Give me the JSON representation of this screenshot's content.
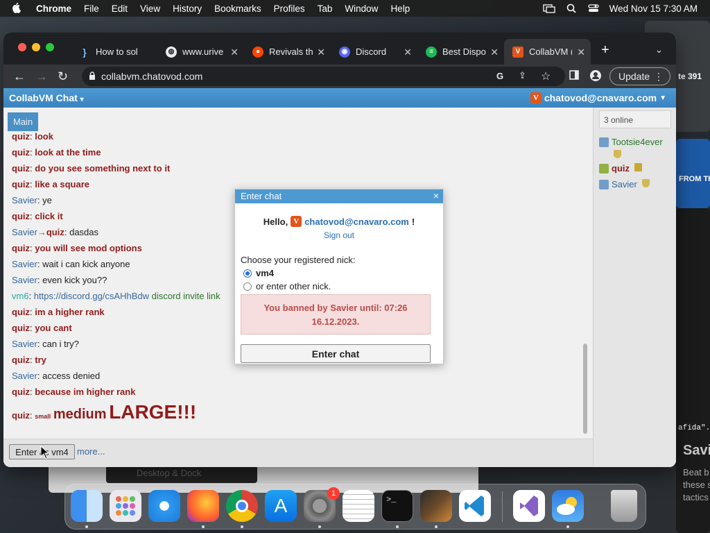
{
  "menubar": {
    "app": "Chrome",
    "items": [
      "File",
      "Edit",
      "View",
      "History",
      "Bookmarks",
      "Profiles",
      "Tab",
      "Window",
      "Help"
    ],
    "datetime": "Wed Nov 15  7:30 AM"
  },
  "background": {
    "right_number": "te 391",
    "from_text": "FROM TH",
    "code_snippet": "afida\".",
    "heading": "Savi",
    "lines": [
      "Beat b",
      "these s",
      "tactics"
    ],
    "desktop_dock": "Desktop & Dock"
  },
  "browser": {
    "tabs": [
      {
        "label": "How to sol",
        "icon": "bracket-icon"
      },
      {
        "label": "www.urive",
        "icon": "globe-icon"
      },
      {
        "label": "Revivals th",
        "icon": "reddit-icon"
      },
      {
        "label": "Discord",
        "icon": "discord-icon"
      },
      {
        "label": "Best Dispo",
        "icon": "spotify-icon"
      },
      {
        "label": "CollabVM (",
        "icon": "collabvm-icon"
      }
    ],
    "url": "collabvm.chatovod.com",
    "update_label": "Update"
  },
  "page": {
    "brand": "CollabVM Chat",
    "brand_caret": "▾",
    "user_email": "chatovod@cnavaro.com",
    "main_tab": "Main",
    "online_count": "3 online",
    "users": [
      {
        "name": "Tootsie4ever",
        "color": "#2a7d2a",
        "badge": "shield"
      },
      {
        "name": "quiz",
        "color": "#9b1d1d",
        "badge": "crown"
      },
      {
        "name": "Savier",
        "color": "#3a6ea5",
        "badge": "shield"
      }
    ],
    "messages": [
      {
        "author": "quiz",
        "sep": ": ",
        "text": "look"
      },
      {
        "author": "quiz",
        "sep": ": ",
        "text": "look at the time"
      },
      {
        "author": "quiz",
        "sep": ": ",
        "text": "do you see something next to it"
      },
      {
        "author": "quiz",
        "sep": ": ",
        "text": "like a square"
      },
      {
        "author": "Savier",
        "sep": ": ",
        "text": "ye"
      },
      {
        "author": "quiz",
        "sep": ": ",
        "text": "click it"
      },
      {
        "author": "Savier",
        "arrow": "→",
        "to": "quiz",
        "sep": ": ",
        "text": "dasdas"
      },
      {
        "author": "quiz",
        "sep": ": ",
        "text": "you will see mod options"
      },
      {
        "author": "Savier",
        "sep": ": ",
        "text": "wait i can kick anyone"
      },
      {
        "author": "Savier",
        "sep": ": ",
        "text": "even kick you??"
      },
      {
        "author": "vm6",
        "sep": ": ",
        "link": "https://discord.gg/csAHhBdw",
        "text": " discord invite link"
      },
      {
        "author": "quiz",
        "sep": ": ",
        "text": "im a higher rank"
      },
      {
        "author": "quiz",
        "sep": ": ",
        "text": "you cant"
      },
      {
        "author": "Savier",
        "sep": ": ",
        "text": "can i try?"
      },
      {
        "author": "quiz",
        "sep": ": ",
        "text": "try"
      },
      {
        "author": "Savier",
        "sep": ": ",
        "text": "access denied"
      },
      {
        "author": "quiz",
        "sep": ": ",
        "text": "because im higher rank"
      }
    ],
    "last_message": {
      "author": "quiz",
      "sep": ": ",
      "small": "small",
      "medium": "medium",
      "large": "LARGE!!!"
    },
    "enter_button": "Enter as vm4",
    "more_link": "more..."
  },
  "dialog": {
    "title": "Enter chat",
    "close": "×",
    "hello": "Hello,",
    "email": "chatovod@cnavaro.com",
    "exclaim": "!",
    "signout": "Sign out",
    "choose": "Choose your registered nick:",
    "option_nick": "vm4",
    "option_other": "or enter other nick.",
    "ban_message": "You banned by Savier until: 07:26 16.12.2023.",
    "enter_button": "Enter chat"
  },
  "dock": {
    "apps": [
      "finder-icon",
      "launchpad-icon",
      "safari-icon",
      "firefox-icon",
      "chrome-icon",
      "appstore-icon",
      "settings-icon",
      "textedit-icon",
      "terminal-icon",
      "garageband-icon",
      "vscode-icon",
      "visualstudio-icon",
      "weather-icon",
      "trash-icon"
    ],
    "settings_badge": "1"
  }
}
